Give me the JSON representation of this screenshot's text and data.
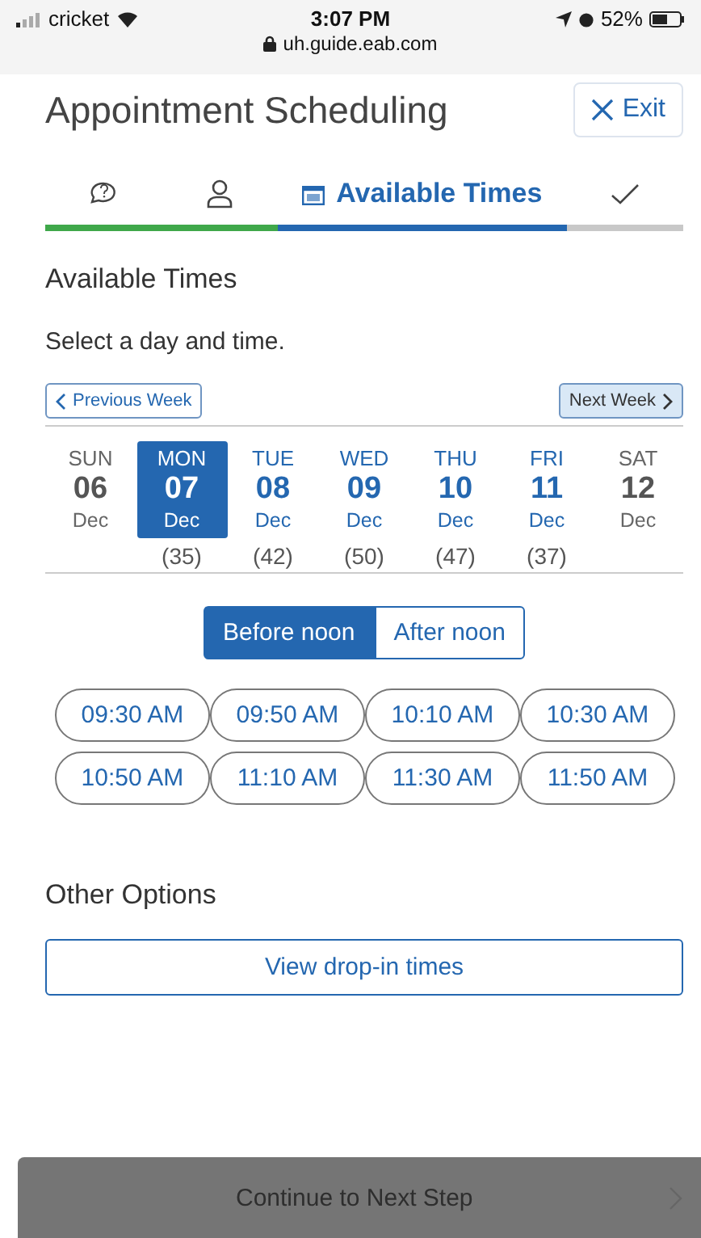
{
  "status_bar": {
    "carrier": "cricket",
    "time": "3:07 PM",
    "battery": "52%",
    "url": "uh.guide.eab.com"
  },
  "header": {
    "title": "Appointment Scheduling",
    "exit": "Exit"
  },
  "steps": [
    {
      "kind": "chat",
      "completed": true,
      "selected": false
    },
    {
      "kind": "person",
      "completed": true,
      "selected": false
    },
    {
      "kind": "calendar",
      "completed": false,
      "selected": true,
      "label": "Available Times"
    },
    {
      "kind": "check",
      "completed": false,
      "selected": false
    }
  ],
  "section_title": "Available Times",
  "instruction": "Select a day and time.",
  "week_nav": {
    "previous": "Previous Week",
    "next": "Next Week"
  },
  "days": [
    {
      "weekday": "SUN",
      "date": "06",
      "month": "Dec",
      "available": false,
      "selected": false
    },
    {
      "weekday": "MON",
      "date": "07",
      "month": "Dec",
      "available": true,
      "selected": true,
      "count": "(35)"
    },
    {
      "weekday": "TUE",
      "date": "08",
      "month": "Dec",
      "available": true,
      "selected": false,
      "count": "(42)"
    },
    {
      "weekday": "WED",
      "date": "09",
      "month": "Dec",
      "available": true,
      "selected": false,
      "count": "(50)"
    },
    {
      "weekday": "THU",
      "date": "10",
      "month": "Dec",
      "available": true,
      "selected": false,
      "count": "(47)"
    },
    {
      "weekday": "FRI",
      "date": "11",
      "month": "Dec",
      "available": true,
      "selected": false,
      "count": "(37)"
    },
    {
      "weekday": "SAT",
      "date": "12",
      "month": "Dec",
      "available": false,
      "selected": false
    }
  ],
  "periods": [
    {
      "label": "Before noon",
      "selected": true
    },
    {
      "label": "After noon",
      "selected": false
    }
  ],
  "times": [
    "09:30 AM",
    "09:50 AM",
    "10:10 AM",
    "10:30 AM",
    "10:50 AM",
    "11:10 AM",
    "11:30 AM",
    "11:50 AM"
  ],
  "other_options": {
    "title": "Other Options",
    "button": "View drop-in times"
  },
  "continue": {
    "label": "Continue to Next Step",
    "disabled": true
  }
}
